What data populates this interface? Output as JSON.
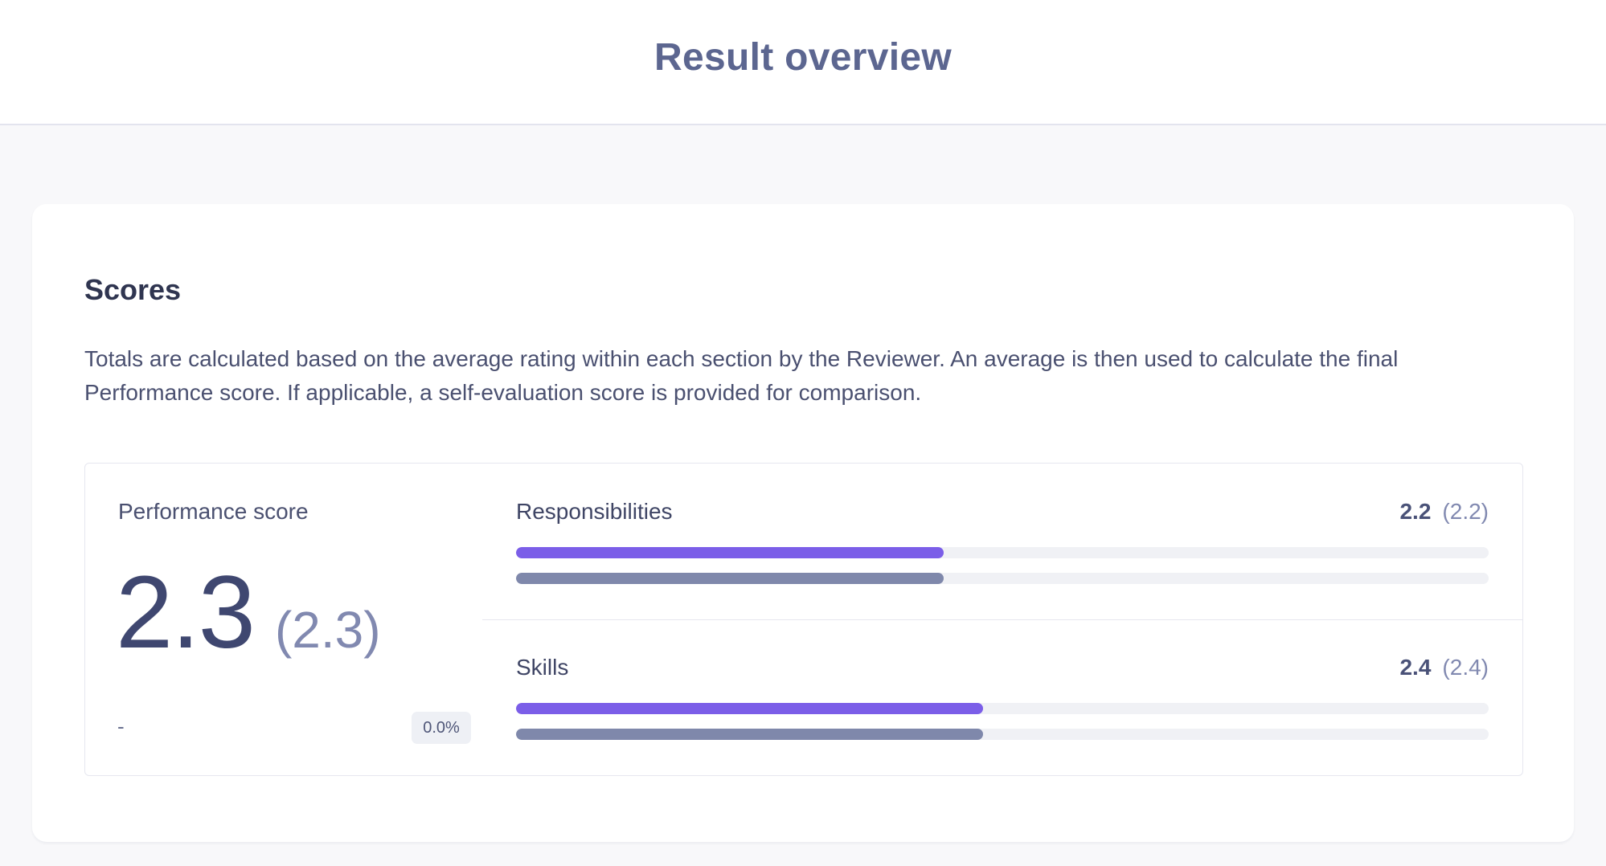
{
  "header": {
    "title": "Result overview"
  },
  "scores": {
    "title": "Scores",
    "description": "Totals are calculated based on the average rating within each section by the Reviewer. An average is then used to calculate the final Performance score. If applicable, a self-evaluation score is provided for comparison.",
    "performance": {
      "label": "Performance score",
      "score": "2.3",
      "self_score": "(2.3)",
      "dash": "-",
      "change": "0.0%"
    },
    "sections": [
      {
        "label": "Responsibilities",
        "score": "2.2",
        "self_score": "(2.2)",
        "reviewer_fraction": 0.44,
        "self_fraction": 0.44
      },
      {
        "label": "Skills",
        "score": "2.4",
        "self_score": "(2.4)",
        "reviewer_fraction": 0.48,
        "self_fraction": 0.48
      }
    ]
  },
  "colors": {
    "title": "#5c6690",
    "reviewer_bar": "#7b5ee8",
    "self_bar": "#7f88ab",
    "track": "#f0f1f5"
  }
}
